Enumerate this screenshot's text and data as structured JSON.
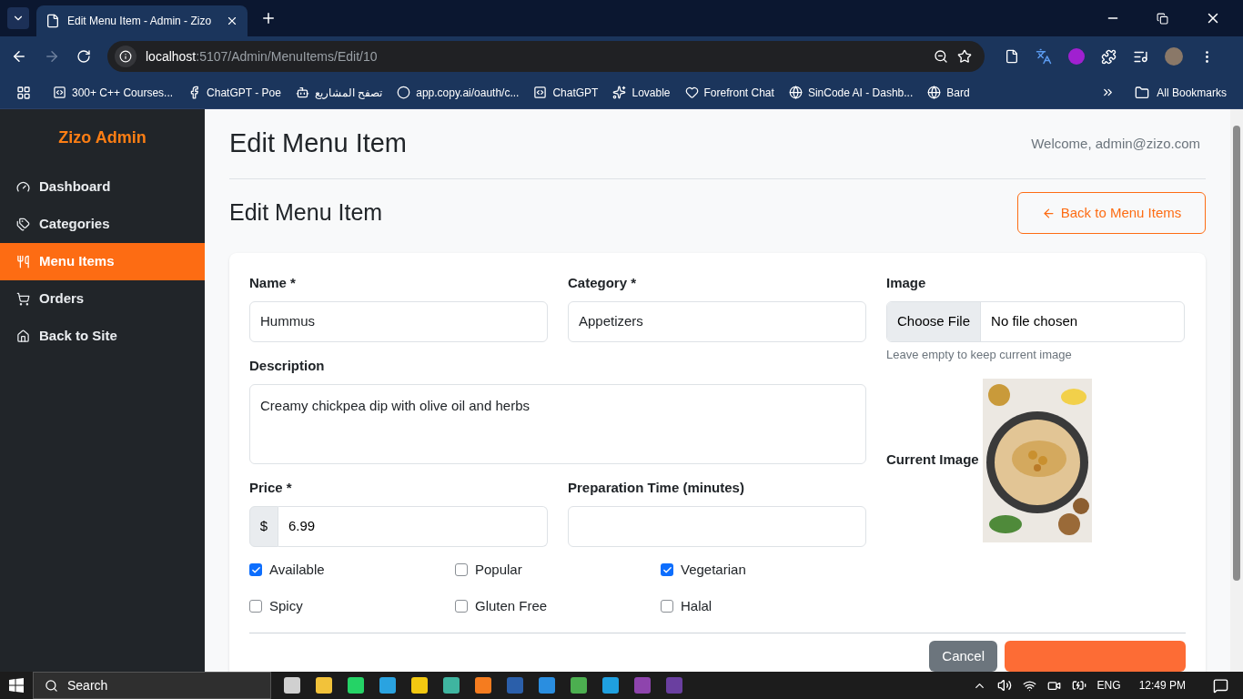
{
  "browser": {
    "tabs": [
      {
        "title": "Edit Menu Item - Admin - Zizo",
        "selected": true
      }
    ],
    "url": {
      "host": "localhost",
      "path": ":5107/Admin/MenuItems/Edit/10"
    },
    "bookmarks": [
      "300+ C++ Courses...",
      "ChatGPT - Poe",
      "تصفح المشاريع",
      "app.copy.ai/oauth/c...",
      "ChatGPT",
      "Lovable",
      "Forefront Chat",
      "SinCode AI - Dashb...",
      "Bard"
    ],
    "all_bookmarks": "All Bookmarks"
  },
  "sidebar": {
    "brand": "Zizo Admin",
    "items": [
      {
        "label": "Dashboard",
        "selected": false
      },
      {
        "label": "Categories",
        "selected": false
      },
      {
        "label": "Menu Items",
        "selected": true
      },
      {
        "label": "Orders",
        "selected": false
      },
      {
        "label": "Back to Site",
        "selected": false
      }
    ]
  },
  "header": {
    "title": "Edit Menu Item",
    "welcome": "Welcome, admin@zizo.com"
  },
  "page": {
    "title": "Edit Menu Item",
    "back_button": "Back to Menu Items"
  },
  "form": {
    "name": {
      "label": "Name *",
      "value": "Hummus"
    },
    "category": {
      "label": "Category *",
      "value": "Appetizers"
    },
    "image": {
      "label": "Image",
      "button": "Choose File",
      "status": "No file chosen",
      "hint": "Leave empty to keep current image",
      "current_label": "Current Image"
    },
    "description": {
      "label": "Description",
      "value": "Creamy chickpea dip with olive oil and herbs"
    },
    "price": {
      "label": "Price *",
      "prefix": "$",
      "value": "6.99"
    },
    "prep_time": {
      "label": "Preparation Time (minutes)"
    },
    "flags": [
      {
        "label": "Available",
        "checked": true
      },
      {
        "label": "Popular",
        "checked": false
      },
      {
        "label": "Vegetarian",
        "checked": true
      },
      {
        "label": "Spicy",
        "checked": false
      },
      {
        "label": "Gluten Free",
        "checked": false
      },
      {
        "label": "Halal",
        "checked": false
      }
    ],
    "cancel_button": "Cancel"
  },
  "taskbar": {
    "search": "Search",
    "language": "ENG",
    "time": "12:49 PM"
  }
}
